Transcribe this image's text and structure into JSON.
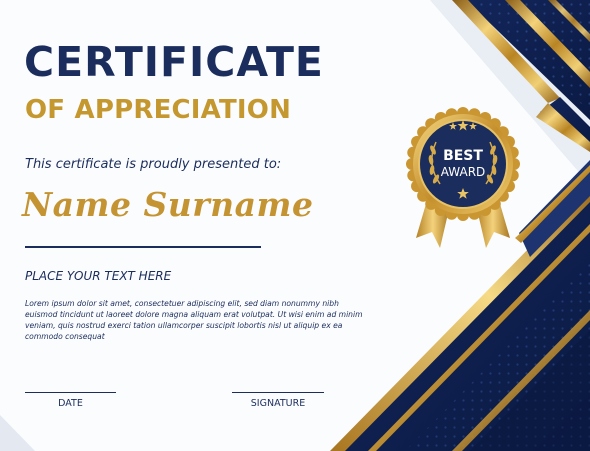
{
  "certificate": {
    "title": "CERTIFICATE",
    "subtitle": "OF APPRECIATION",
    "presented_text": "This certificate is proudly presented to:",
    "recipient_name": "Name Surname",
    "place_text": "PLACE YOUR TEXT HERE",
    "body_text": "Lorem ipsum dolor sit amet, consectetuer adipiscing elit, sed diam nonummy nibh euismod tincidunt ut laoreet dolore magna aliquam erat volutpat. Ut wisi enim ad minim veniam, quis nostrud exerci tation ullamcorper suscipit lobortis nisl ut aliquip ex ea commodo consequat",
    "date_label": "DATE",
    "signature_label": "SIGNATURE"
  },
  "badge": {
    "line1": "BEST",
    "line2": "AWARD"
  },
  "colors": {
    "navy": "#1b2d5c",
    "gold": "#c59432",
    "background": "#fbfcfe"
  },
  "icons": [
    "laurel-wreath-icon",
    "star-icon",
    "award-ribbon-icon"
  ]
}
